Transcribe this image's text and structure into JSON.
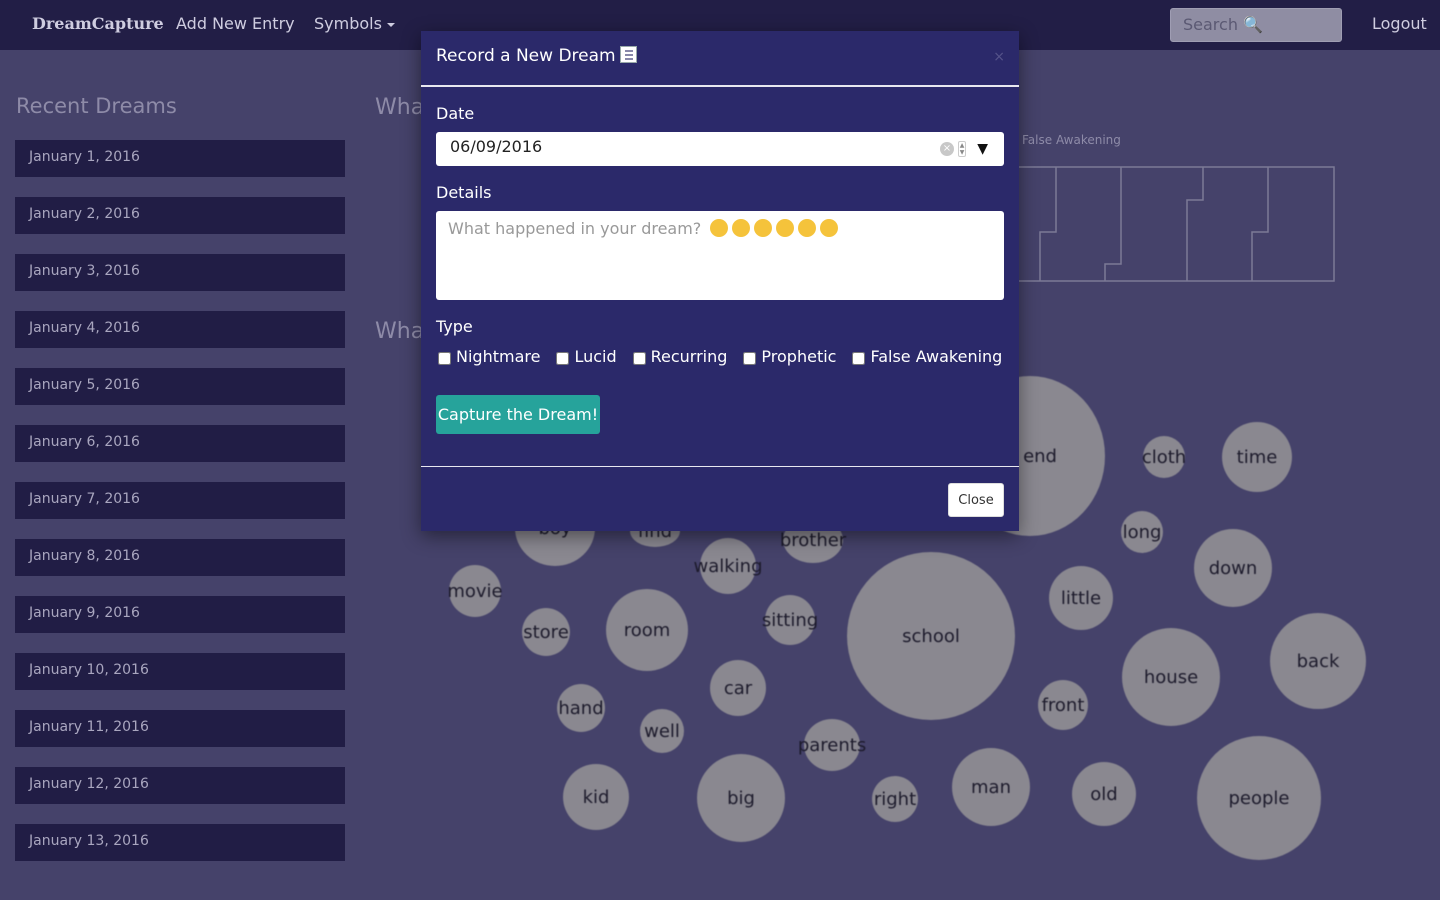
{
  "nav": {
    "brand": "DreamCapture",
    "add_entry": "Add New Entry",
    "symbols": "Symbols",
    "search_placeholder": "Search",
    "logout": "Logout"
  },
  "sidebar": {
    "title": "Recent Dreams",
    "items": [
      "January 1, 2016",
      "January 2, 2016",
      "January 3, 2016",
      "January 4, 2016",
      "January 5, 2016",
      "January 6, 2016",
      "January 7, 2016",
      "January 8, 2016",
      "January 9, 2016",
      "January 10, 2016",
      "January 11, 2016",
      "January 12, 2016",
      "January 13, 2016"
    ]
  },
  "background": {
    "heading_1": "Wha",
    "heading_2": "Wha",
    "chart_legend": "False Awakening",
    "bubbles": [
      "end",
      "cloth",
      "time",
      "long",
      "down",
      "brother",
      "walking",
      "movie",
      "little",
      "store",
      "room",
      "sitting",
      "school",
      "back",
      "house",
      "car",
      "hand",
      "front",
      "well",
      "parents",
      "kid",
      "big",
      "right",
      "man",
      "old",
      "people",
      "boy",
      "find"
    ]
  },
  "modal": {
    "title": "Record a New Dream",
    "date_label": "Date",
    "date_value": "06/09/2016",
    "details_label": "Details",
    "details_placeholder": "What happened in your dream?",
    "type_label": "Type",
    "types": [
      "Nightmare",
      "Lucid",
      "Recurring",
      "Prophetic",
      "False Awakening"
    ],
    "capture_button": "Capture the Dream!",
    "close_button": "Close",
    "close_x": "×"
  }
}
